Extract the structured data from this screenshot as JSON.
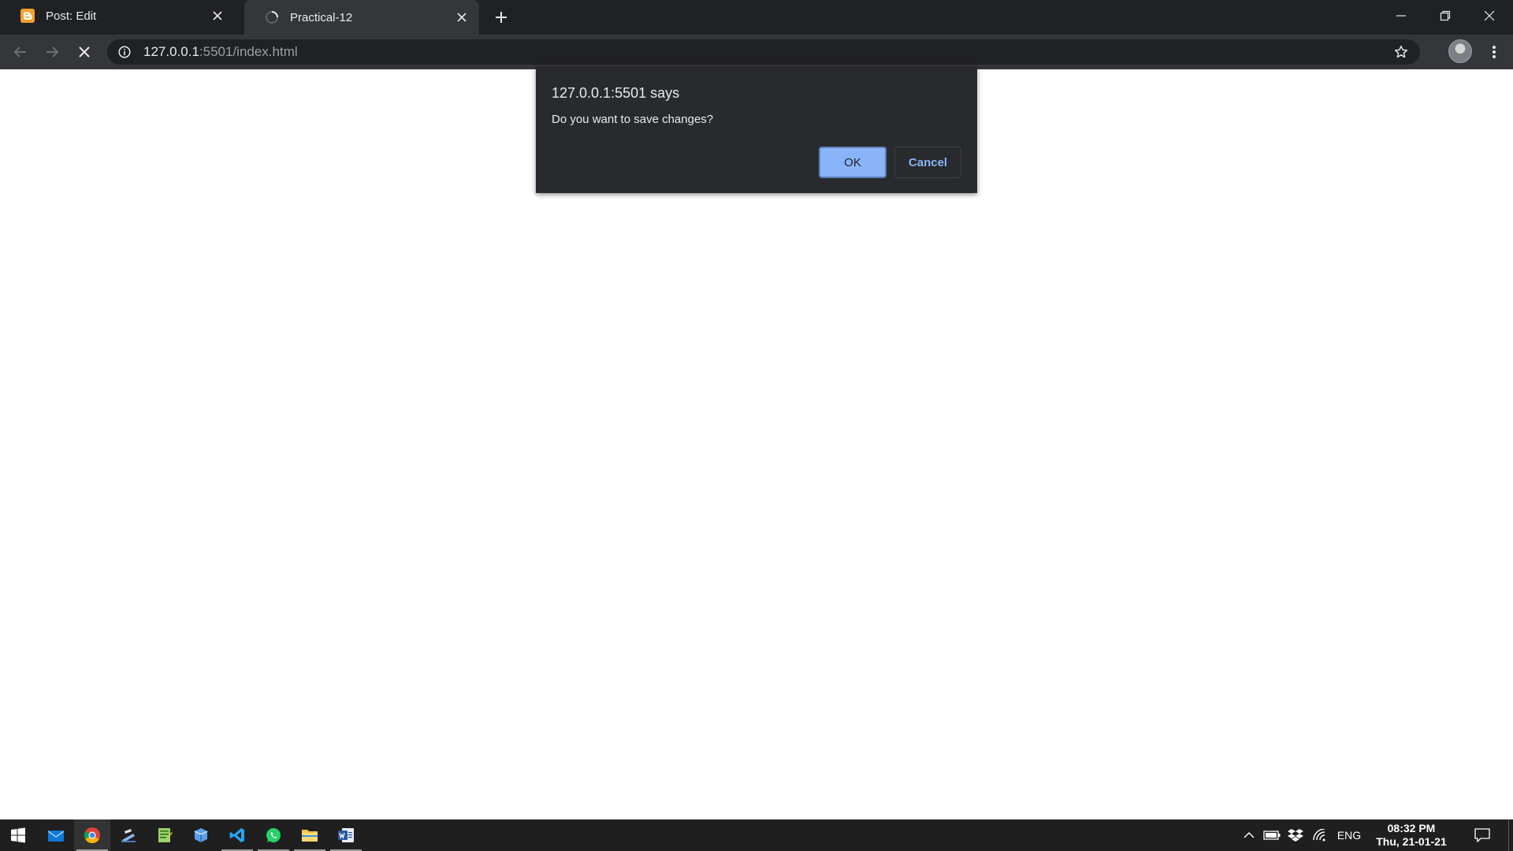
{
  "tabs": [
    {
      "title": "Post: Edit",
      "favicon": "blogger-icon",
      "active": false
    },
    {
      "title": "Practical-12",
      "favicon": "loading-spinner-icon",
      "active": true
    }
  ],
  "address_bar": {
    "host": "127.0.0.1",
    "port_path": ":5501/index.html"
  },
  "dialog": {
    "title": "127.0.0.1:5501 says",
    "message": "Do you want to save changes?",
    "ok_label": "OK",
    "cancel_label": "Cancel"
  },
  "taskbar": {
    "apps": [
      "start-icon",
      "mail-icon",
      "chrome-icon",
      "tool-icon",
      "notepad-icon",
      "box-icon",
      "vscode-icon",
      "whatsapp-icon",
      "file-explorer-icon",
      "word-icon"
    ],
    "language": "ENG",
    "time": "08:32 PM",
    "date": "Thu, 21-01-21"
  },
  "colors": {
    "accent": "#8ab4f8",
    "frame": "#202124",
    "toolbar": "#35363a",
    "dialog_bg": "#292a2d"
  }
}
